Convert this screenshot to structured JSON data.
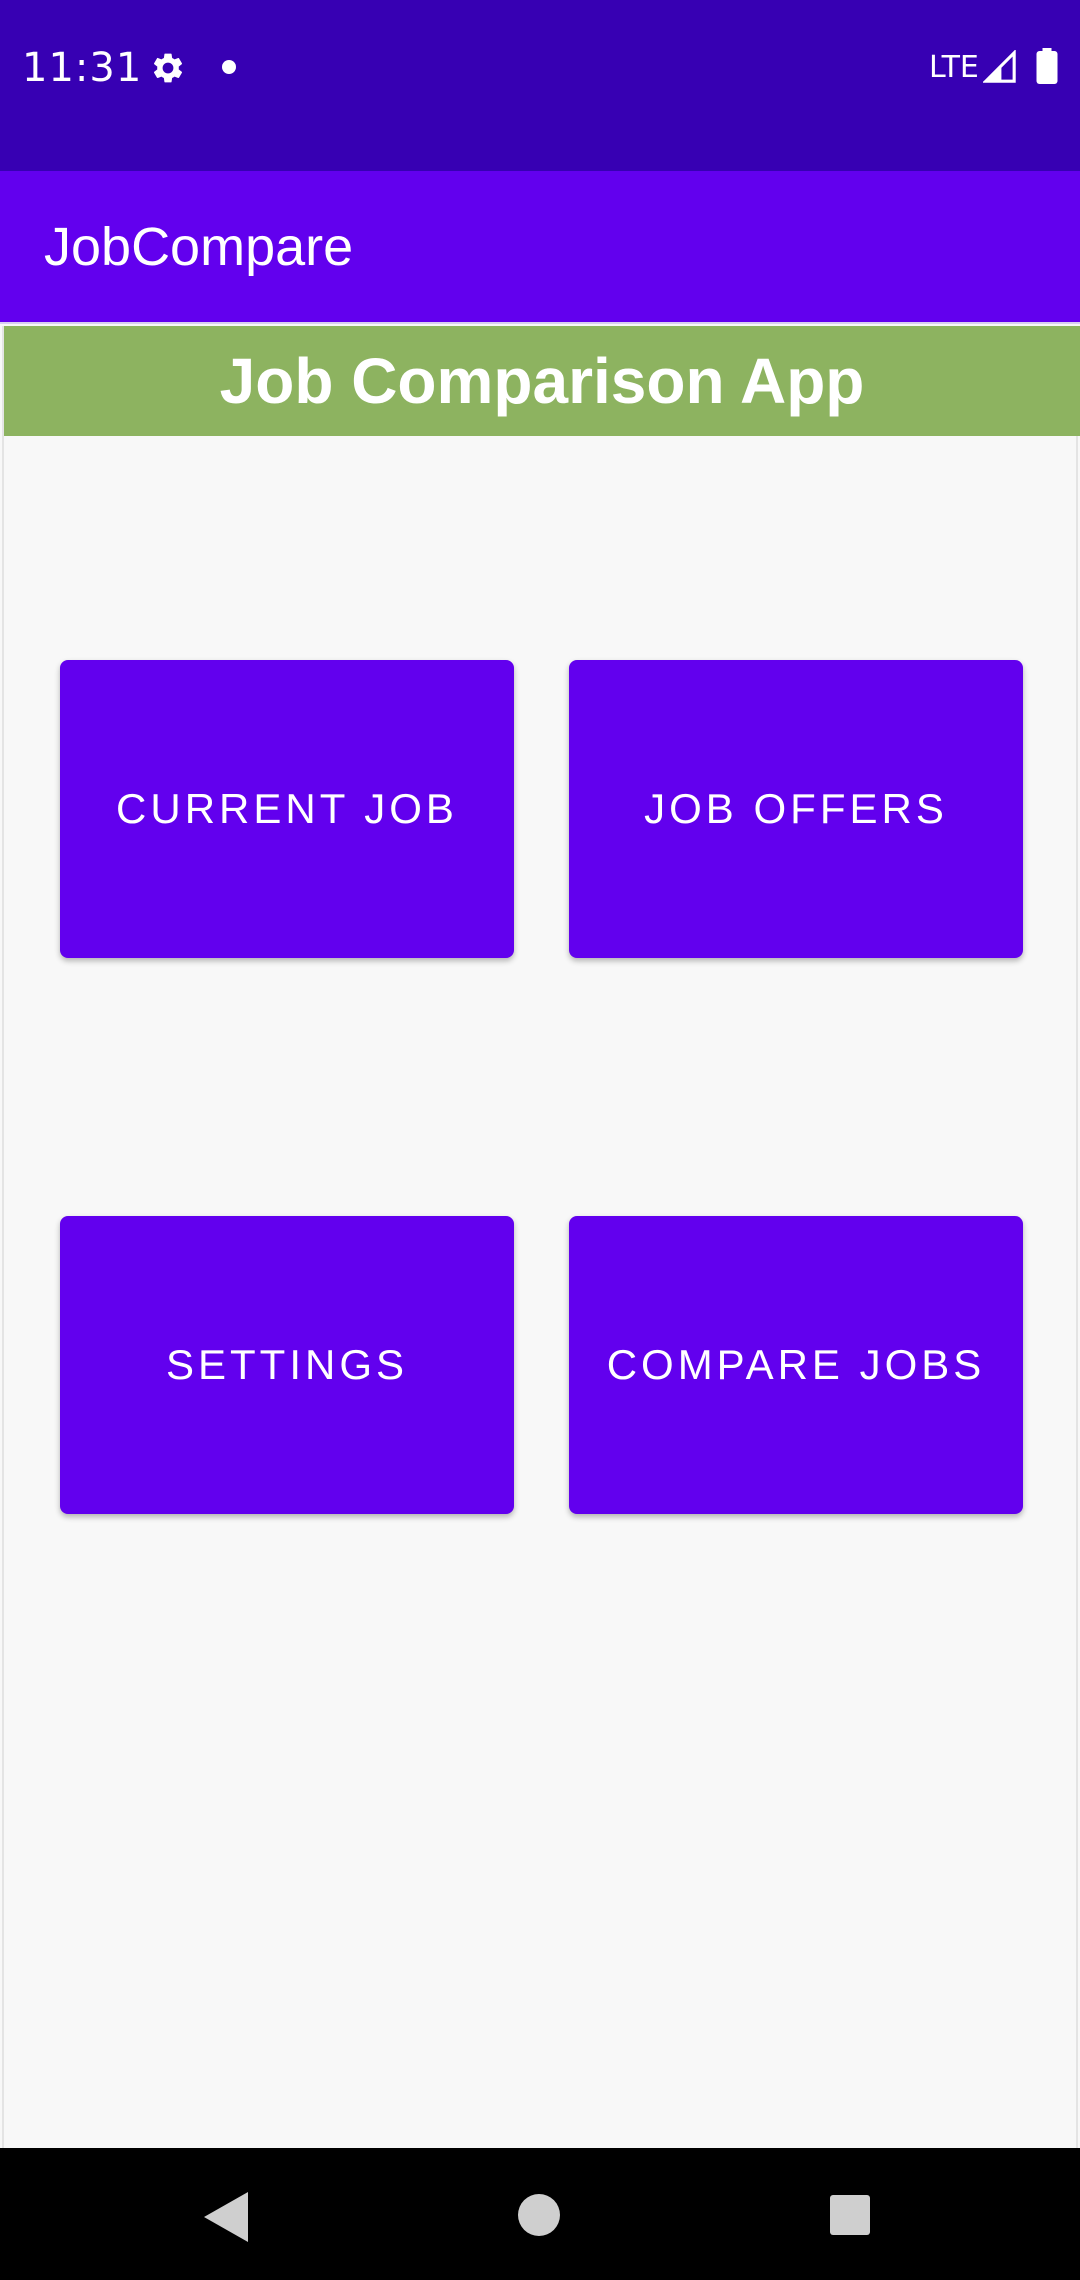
{
  "status_bar": {
    "time": "11:31",
    "network": "LTE",
    "icons": [
      "gear-icon",
      "notification-dot-icon",
      "signal-icon",
      "battery-icon"
    ]
  },
  "app_bar": {
    "title": "JobCompare"
  },
  "header": {
    "title": "Job Comparison App"
  },
  "buttons": {
    "current_job": "CURRENT JOB",
    "job_offers": "JOB OFFERS",
    "settings": "SETTINGS",
    "compare_jobs": "COMPARE JOBS"
  },
  "nav_bar": {
    "icons": [
      "back-icon",
      "home-icon",
      "recents-icon"
    ]
  },
  "colors": {
    "status_bar": "#3700b3",
    "primary": "#6200ee",
    "header_banner": "#8db360",
    "background": "#f8f8f8"
  }
}
